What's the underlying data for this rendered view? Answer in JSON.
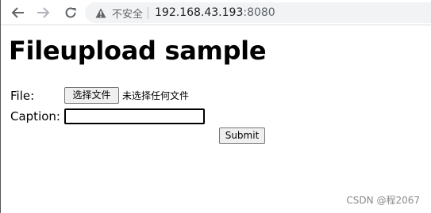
{
  "browser": {
    "security_label": "不安全",
    "url_host": "192.168.43.193",
    "url_port": ":8080",
    "icons": {
      "back": "back-arrow-icon",
      "forward": "forward-arrow-icon",
      "reload": "reload-icon",
      "security": "warning-icon"
    }
  },
  "page": {
    "title": "Fileupload sample",
    "form": {
      "file_label": "File:",
      "choose_file_button": "选择文件",
      "no_file_text": "未选择任何文件",
      "caption_label": "Caption:",
      "caption_value": "",
      "submit_label": "Submit"
    }
  },
  "watermark": {
    "text": "CSDN @程2067"
  }
}
